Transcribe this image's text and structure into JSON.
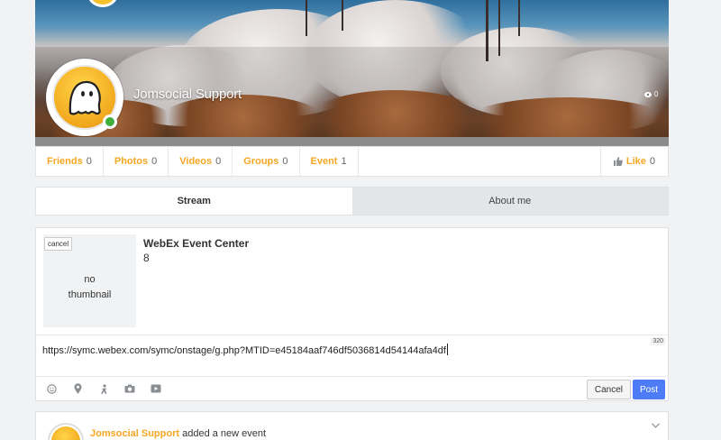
{
  "profile": {
    "name": "Jomsocial Support",
    "views": "0",
    "shares": ""
  },
  "counts": [
    {
      "label": "Friends",
      "value": "0"
    },
    {
      "label": "Photos",
      "value": "0"
    },
    {
      "label": "Videos",
      "value": "0"
    },
    {
      "label": "Groups",
      "value": "0"
    },
    {
      "label": "Event",
      "value": "1"
    }
  ],
  "like": {
    "label": "Like",
    "value": "0"
  },
  "tabs": [
    {
      "label": "Stream"
    },
    {
      "label": "About me"
    }
  ],
  "composer": {
    "preview_cancel": "cancel",
    "no_thumbnail_line1": "no",
    "no_thumbnail_line2": "thumbnail",
    "link_title": "WebEx Event Center",
    "link_description": "8",
    "url": "https://symc.webex.com/symc/onstage/g.php?MTID=e45184aaf746df5036814d54144afa4df",
    "char_count": "320",
    "cancel_label": "Cancel",
    "post_label": "Post",
    "tools": [
      "emoji-icon",
      "location-icon",
      "mood-icon",
      "camera-icon",
      "video-icon"
    ]
  },
  "activity": {
    "actor": "Jomsocial Support",
    "action": "added a new event"
  },
  "colors": {
    "accent": "#f5a623",
    "post_button": "#4d7cf6",
    "online": "#3fae3b"
  }
}
